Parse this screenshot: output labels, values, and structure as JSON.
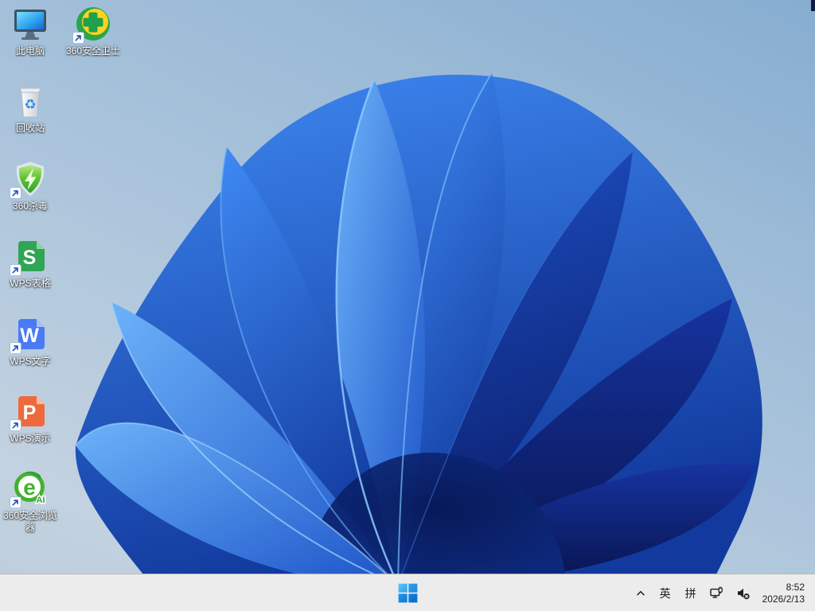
{
  "wallpaper": {
    "name": "windows-11-bloom"
  },
  "desktop": {
    "icons": [
      {
        "id": "this-pc",
        "label": "此电脑",
        "col": 1,
        "row": 1,
        "shortcut": false
      },
      {
        "id": "360-safety-guard",
        "label": "360安全卫士",
        "col": 2,
        "row": 1,
        "shortcut": true
      },
      {
        "id": "recycle-bin",
        "label": "回收站",
        "col": 1,
        "row": 2,
        "shortcut": false
      },
      {
        "id": "360-antivirus",
        "label": "360杀毒",
        "col": 1,
        "row": 3,
        "shortcut": true
      },
      {
        "id": "wps-spreadsheet",
        "label": "WPS表格",
        "col": 1,
        "row": 4,
        "shortcut": true,
        "letter": "S"
      },
      {
        "id": "wps-writer",
        "label": "WPS文字",
        "col": 1,
        "row": 5,
        "shortcut": true,
        "letter": "W"
      },
      {
        "id": "wps-presentation",
        "label": "WPS演示",
        "col": 1,
        "row": 6,
        "shortcut": true,
        "letter": "P"
      },
      {
        "id": "360-browser",
        "label": "360安全浏览器",
        "col": 1,
        "row": 7,
        "shortcut": true,
        "letter": "e",
        "badge": "AI"
      }
    ]
  },
  "taskbar": {
    "tray": {
      "language": "英",
      "ime_mode": "拼",
      "time": "8:52",
      "date": "2026/2/13"
    }
  },
  "glyphs": {
    "recycle": "♻"
  },
  "colors": {
    "taskbar_bg": "#ececec",
    "wps_spreadsheet": "#30a554",
    "wps_spreadsheet_fold": "#8fd4a4",
    "wps_writer": "#4a7bf5",
    "wps_writer_fold": "#a8c0fa",
    "wps_presentation": "#ee6a3c",
    "wps_presentation_fold": "#f8b99c",
    "shield_green": "#63c432",
    "guard_yellow": "#ffd41d",
    "guard_green": "#2aa54a",
    "browser_green": "#44b12e",
    "screen_blue": "#30a6ee"
  }
}
